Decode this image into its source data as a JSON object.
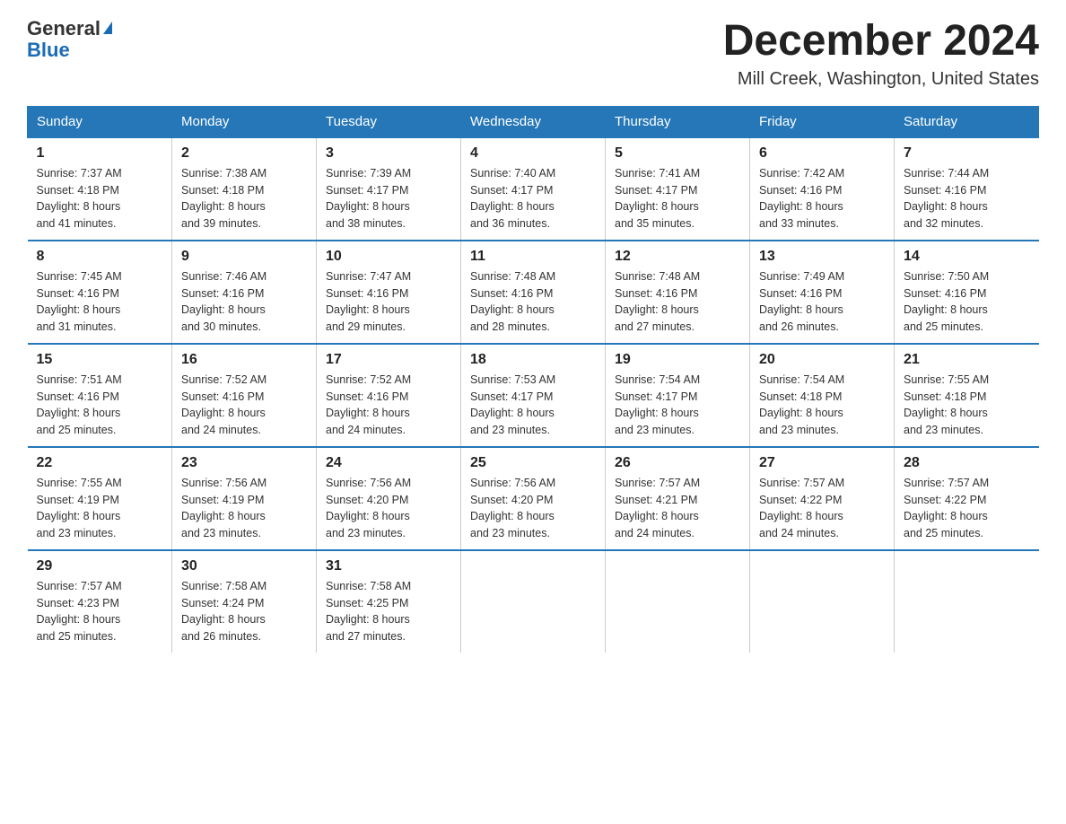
{
  "header": {
    "logo_general": "General",
    "logo_blue": "Blue",
    "title": "December 2024",
    "subtitle": "Mill Creek, Washington, United States"
  },
  "days_of_week": [
    "Sunday",
    "Monday",
    "Tuesday",
    "Wednesday",
    "Thursday",
    "Friday",
    "Saturday"
  ],
  "weeks": [
    [
      {
        "day": "1",
        "sunrise": "7:37 AM",
        "sunset": "4:18 PM",
        "daylight": "8 hours and 41 minutes."
      },
      {
        "day": "2",
        "sunrise": "7:38 AM",
        "sunset": "4:18 PM",
        "daylight": "8 hours and 39 minutes."
      },
      {
        "day": "3",
        "sunrise": "7:39 AM",
        "sunset": "4:17 PM",
        "daylight": "8 hours and 38 minutes."
      },
      {
        "day": "4",
        "sunrise": "7:40 AM",
        "sunset": "4:17 PM",
        "daylight": "8 hours and 36 minutes."
      },
      {
        "day": "5",
        "sunrise": "7:41 AM",
        "sunset": "4:17 PM",
        "daylight": "8 hours and 35 minutes."
      },
      {
        "day": "6",
        "sunrise": "7:42 AM",
        "sunset": "4:16 PM",
        "daylight": "8 hours and 33 minutes."
      },
      {
        "day": "7",
        "sunrise": "7:44 AM",
        "sunset": "4:16 PM",
        "daylight": "8 hours and 32 minutes."
      }
    ],
    [
      {
        "day": "8",
        "sunrise": "7:45 AM",
        "sunset": "4:16 PM",
        "daylight": "8 hours and 31 minutes."
      },
      {
        "day": "9",
        "sunrise": "7:46 AM",
        "sunset": "4:16 PM",
        "daylight": "8 hours and 30 minutes."
      },
      {
        "day": "10",
        "sunrise": "7:47 AM",
        "sunset": "4:16 PM",
        "daylight": "8 hours and 29 minutes."
      },
      {
        "day": "11",
        "sunrise": "7:48 AM",
        "sunset": "4:16 PM",
        "daylight": "8 hours and 28 minutes."
      },
      {
        "day": "12",
        "sunrise": "7:48 AM",
        "sunset": "4:16 PM",
        "daylight": "8 hours and 27 minutes."
      },
      {
        "day": "13",
        "sunrise": "7:49 AM",
        "sunset": "4:16 PM",
        "daylight": "8 hours and 26 minutes."
      },
      {
        "day": "14",
        "sunrise": "7:50 AM",
        "sunset": "4:16 PM",
        "daylight": "8 hours and 25 minutes."
      }
    ],
    [
      {
        "day": "15",
        "sunrise": "7:51 AM",
        "sunset": "4:16 PM",
        "daylight": "8 hours and 25 minutes."
      },
      {
        "day": "16",
        "sunrise": "7:52 AM",
        "sunset": "4:16 PM",
        "daylight": "8 hours and 24 minutes."
      },
      {
        "day": "17",
        "sunrise": "7:52 AM",
        "sunset": "4:16 PM",
        "daylight": "8 hours and 24 minutes."
      },
      {
        "day": "18",
        "sunrise": "7:53 AM",
        "sunset": "4:17 PM",
        "daylight": "8 hours and 23 minutes."
      },
      {
        "day": "19",
        "sunrise": "7:54 AM",
        "sunset": "4:17 PM",
        "daylight": "8 hours and 23 minutes."
      },
      {
        "day": "20",
        "sunrise": "7:54 AM",
        "sunset": "4:18 PM",
        "daylight": "8 hours and 23 minutes."
      },
      {
        "day": "21",
        "sunrise": "7:55 AM",
        "sunset": "4:18 PM",
        "daylight": "8 hours and 23 minutes."
      }
    ],
    [
      {
        "day": "22",
        "sunrise": "7:55 AM",
        "sunset": "4:19 PM",
        "daylight": "8 hours and 23 minutes."
      },
      {
        "day": "23",
        "sunrise": "7:56 AM",
        "sunset": "4:19 PM",
        "daylight": "8 hours and 23 minutes."
      },
      {
        "day": "24",
        "sunrise": "7:56 AM",
        "sunset": "4:20 PM",
        "daylight": "8 hours and 23 minutes."
      },
      {
        "day": "25",
        "sunrise": "7:56 AM",
        "sunset": "4:20 PM",
        "daylight": "8 hours and 23 minutes."
      },
      {
        "day": "26",
        "sunrise": "7:57 AM",
        "sunset": "4:21 PM",
        "daylight": "8 hours and 24 minutes."
      },
      {
        "day": "27",
        "sunrise": "7:57 AM",
        "sunset": "4:22 PM",
        "daylight": "8 hours and 24 minutes."
      },
      {
        "day": "28",
        "sunrise": "7:57 AM",
        "sunset": "4:22 PM",
        "daylight": "8 hours and 25 minutes."
      }
    ],
    [
      {
        "day": "29",
        "sunrise": "7:57 AM",
        "sunset": "4:23 PM",
        "daylight": "8 hours and 25 minutes."
      },
      {
        "day": "30",
        "sunrise": "7:58 AM",
        "sunset": "4:24 PM",
        "daylight": "8 hours and 26 minutes."
      },
      {
        "day": "31",
        "sunrise": "7:58 AM",
        "sunset": "4:25 PM",
        "daylight": "8 hours and 27 minutes."
      },
      null,
      null,
      null,
      null
    ]
  ],
  "labels": {
    "sunrise": "Sunrise:",
    "sunset": "Sunset:",
    "daylight": "Daylight:"
  }
}
